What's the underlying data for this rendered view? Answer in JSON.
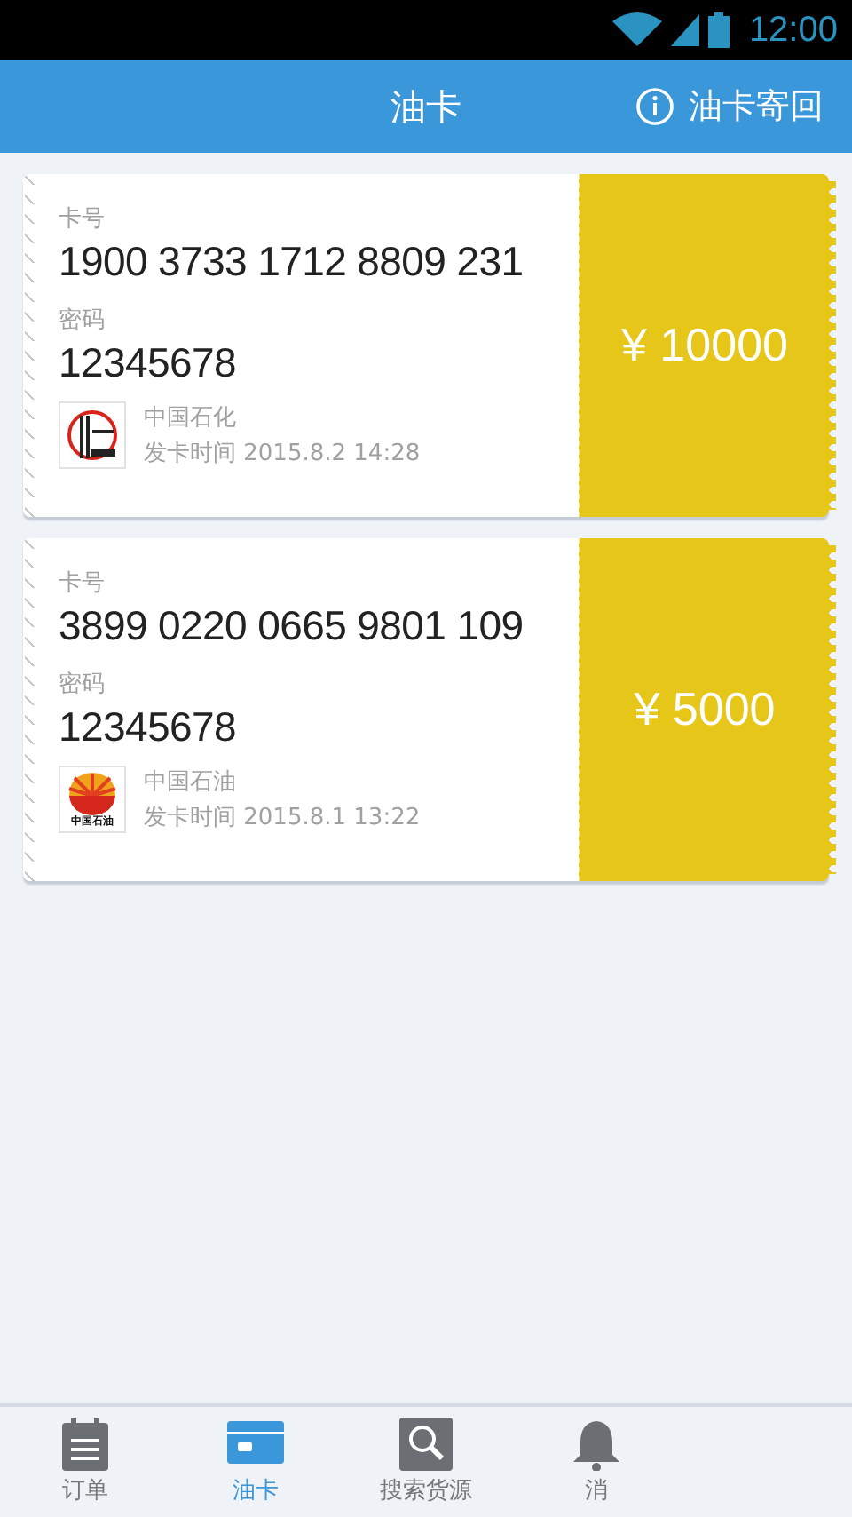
{
  "status_bar": {
    "time": "12:00"
  },
  "header": {
    "title": "油卡",
    "action": "油卡寄回"
  },
  "cards": [
    {
      "number_label": "卡号",
      "number": "1900 3733 1712 8809 231",
      "password_label": "密码",
      "password": "12345678",
      "kind": "ring",
      "company": "中国石化",
      "issued": "发卡时间 2015.8.2 14:28",
      "amount": "¥ 10000"
    },
    {
      "number_label": "卡号",
      "number": "3899 0220 0665 9801 109",
      "password_label": "密码",
      "password": "12345678",
      "kind": "shell",
      "logo_text": "中国石油",
      "company": "中国石油",
      "issued": "发卡时间 2015.8.1 13:22",
      "amount": "¥ 5000"
    }
  ],
  "tabs": [
    {
      "label": "订单",
      "kind": "notepad",
      "selected": false
    },
    {
      "label": "油卡",
      "kind": "card",
      "selected": true
    },
    {
      "label": "搜索货源",
      "kind": "search",
      "selected": false
    },
    {
      "label": "消",
      "kind": "bell",
      "selected": false
    }
  ]
}
